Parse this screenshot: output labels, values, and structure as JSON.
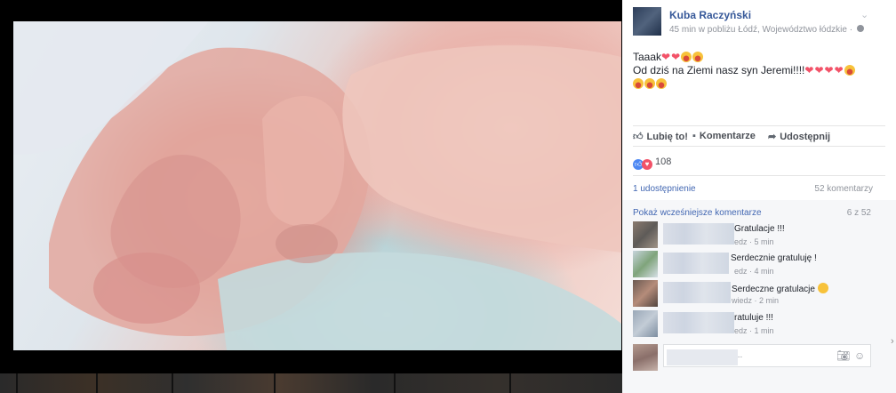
{
  "post": {
    "author": "Kuba Raczyński",
    "meta": "45 min w pobliżu Łódź, Województwo łódzkie ·",
    "text_line1": "Taaak",
    "text_line2": "Od dziś na Ziemi nasz syn Jeremi!!!!"
  },
  "actions": {
    "like": "Lubię to!",
    "comment": "Komentarze",
    "share": "Udostępnij"
  },
  "reactions": {
    "count": "108"
  },
  "stats": {
    "shares": "1 udostępnienie",
    "comments": "52 komentarzy"
  },
  "comments_section": {
    "previous_link": "Pokaż wcześniejsze komentarze",
    "pager": "6 z 52",
    "items": [
      {
        "text": "Gratulacje !!!",
        "meta": "edz · 5 min"
      },
      {
        "text": "Serdecznie gratuluję !",
        "meta": "edz · 4 min"
      },
      {
        "text": "Serdeczne gratulacje",
        "meta": "wiedz · 2 min"
      },
      {
        "text": "ratuluje !!!",
        "meta": "edz · 1 min"
      }
    ],
    "composer_placeholder": "..."
  },
  "icons": {
    "like": "thumbs-up-icon",
    "comment": "speech-bubble-icon",
    "share": "share-arrow-icon",
    "camera": "camera-icon",
    "emoji": "smiley-icon",
    "chevron": "chevron-down-icon",
    "globe": "globe-icon"
  },
  "colors": {
    "link": "#365899",
    "heart": "#f25268",
    "like": "#4d88f3"
  }
}
